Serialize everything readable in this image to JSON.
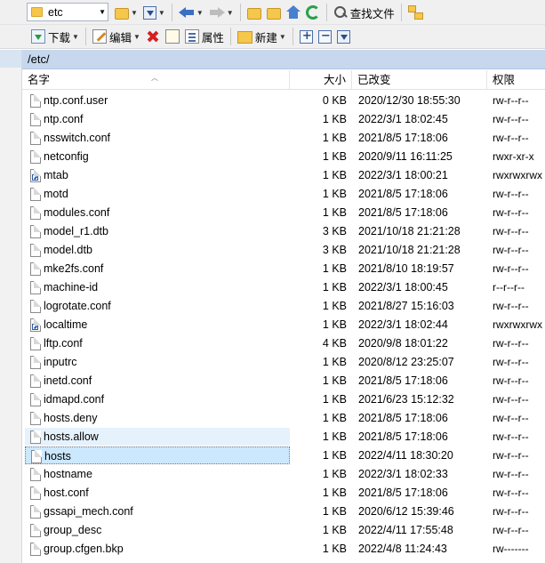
{
  "toolbar": {
    "path_value": "etc",
    "find_label": "查找文件",
    "download_label": "下载",
    "edit_label": "编辑",
    "properties_label": "属性",
    "new_label": "新建"
  },
  "address": "/etc/",
  "columns": {
    "name": "名字",
    "size": "大小",
    "modified": "已改变",
    "permissions": "权限"
  },
  "files": [
    {
      "name": "ntp.conf.user",
      "size": "0 KB",
      "modified": "2020/12/30 18:55:30",
      "perm": "rw-r--r--",
      "link": false
    },
    {
      "name": "ntp.conf",
      "size": "1 KB",
      "modified": "2022/3/1 18:02:45",
      "perm": "rw-r--r--",
      "link": false
    },
    {
      "name": "nsswitch.conf",
      "size": "1 KB",
      "modified": "2021/8/5 17:18:06",
      "perm": "rw-r--r--",
      "link": false
    },
    {
      "name": "netconfig",
      "size": "1 KB",
      "modified": "2020/9/11 16:11:25",
      "perm": "rwxr-xr-x",
      "link": false
    },
    {
      "name": "mtab",
      "size": "1 KB",
      "modified": "2022/3/1 18:00:21",
      "perm": "rwxrwxrwx",
      "link": true
    },
    {
      "name": "motd",
      "size": "1 KB",
      "modified": "2021/8/5 17:18:06",
      "perm": "rw-r--r--",
      "link": false
    },
    {
      "name": "modules.conf",
      "size": "1 KB",
      "modified": "2021/8/5 17:18:06",
      "perm": "rw-r--r--",
      "link": false
    },
    {
      "name": "model_r1.dtb",
      "size": "3 KB",
      "modified": "2021/10/18 21:21:28",
      "perm": "rw-r--r--",
      "link": false
    },
    {
      "name": "model.dtb",
      "size": "3 KB",
      "modified": "2021/10/18 21:21:28",
      "perm": "rw-r--r--",
      "link": false
    },
    {
      "name": "mke2fs.conf",
      "size": "1 KB",
      "modified": "2021/8/10 18:19:57",
      "perm": "rw-r--r--",
      "link": false
    },
    {
      "name": "machine-id",
      "size": "1 KB",
      "modified": "2022/3/1 18:00:45",
      "perm": "r--r--r--",
      "link": false
    },
    {
      "name": "logrotate.conf",
      "size": "1 KB",
      "modified": "2021/8/27 15:16:03",
      "perm": "rw-r--r--",
      "link": false
    },
    {
      "name": "localtime",
      "size": "1 KB",
      "modified": "2022/3/1 18:02:44",
      "perm": "rwxrwxrwx",
      "link": true
    },
    {
      "name": "lftp.conf",
      "size": "4 KB",
      "modified": "2020/9/8 18:01:22",
      "perm": "rw-r--r--",
      "link": false
    },
    {
      "name": "inputrc",
      "size": "1 KB",
      "modified": "2020/8/12 23:25:07",
      "perm": "rw-r--r--",
      "link": false
    },
    {
      "name": "inetd.conf",
      "size": "1 KB",
      "modified": "2021/8/5 17:18:06",
      "perm": "rw-r--r--",
      "link": false
    },
    {
      "name": "idmapd.conf",
      "size": "1 KB",
      "modified": "2021/6/23 15:12:32",
      "perm": "rw-r--r--",
      "link": false
    },
    {
      "name": "hosts.deny",
      "size": "1 KB",
      "modified": "2021/8/5 17:18:06",
      "perm": "rw-r--r--",
      "link": false
    },
    {
      "name": "hosts.allow",
      "size": "1 KB",
      "modified": "2021/8/5 17:18:06",
      "perm": "rw-r--r--",
      "link": false,
      "hover": true
    },
    {
      "name": "hosts",
      "size": "1 KB",
      "modified": "2022/4/11 18:30:20",
      "perm": "rw-r--r--",
      "link": false,
      "selected": true
    },
    {
      "name": "hostname",
      "size": "1 KB",
      "modified": "2022/3/1 18:02:33",
      "perm": "rw-r--r--",
      "link": false
    },
    {
      "name": "host.conf",
      "size": "1 KB",
      "modified": "2021/8/5 17:18:06",
      "perm": "rw-r--r--",
      "link": false
    },
    {
      "name": "gssapi_mech.conf",
      "size": "1 KB",
      "modified": "2020/6/12 15:39:46",
      "perm": "rw-r--r--",
      "link": false
    },
    {
      "name": "group_desc",
      "size": "1 KB",
      "modified": "2022/4/11 17:55:48",
      "perm": "rw-r--r--",
      "link": false
    },
    {
      "name": "group.cfgen.bkp",
      "size": "1 KB",
      "modified": "2022/4/8 11:24:43",
      "perm": "rw-------",
      "link": false
    }
  ]
}
